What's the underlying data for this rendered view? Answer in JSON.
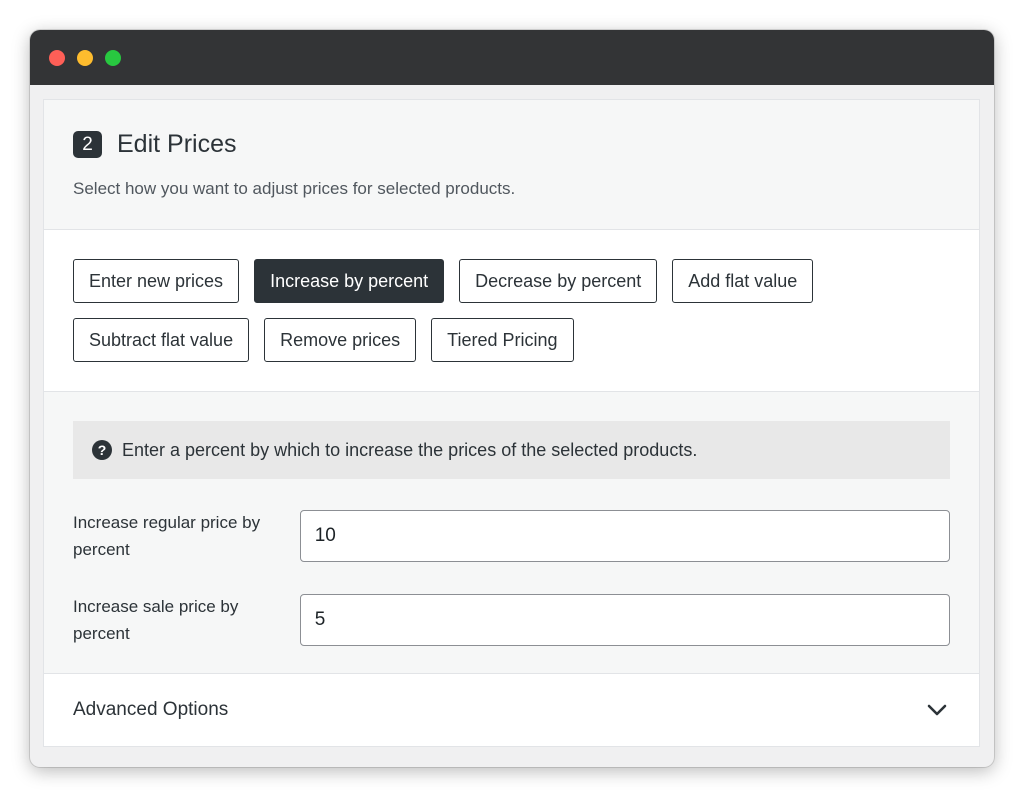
{
  "step": {
    "number": "2",
    "title": "Edit Prices",
    "subtitle": "Select how you want to adjust prices for selected products."
  },
  "options": {
    "row1": [
      {
        "label": "Enter new prices",
        "active": false
      },
      {
        "label": "Increase by percent",
        "active": true
      },
      {
        "label": "Decrease by percent",
        "active": false
      },
      {
        "label": "Add flat value",
        "active": false
      }
    ],
    "row2": [
      {
        "label": "Subtract flat value",
        "active": false
      },
      {
        "label": "Remove prices",
        "active": false
      },
      {
        "label": "Tiered Pricing",
        "active": false
      }
    ]
  },
  "notice": {
    "icon": "help-icon",
    "text": "Enter a percent by which to increase the prices of the selected products."
  },
  "fields": {
    "regular": {
      "label": "Increase regular price by percent",
      "value": "10"
    },
    "sale": {
      "label": "Increase sale price by percent",
      "value": "5"
    }
  },
  "advanced": {
    "label": "Advanced Options",
    "icon": "chevron-down-icon"
  },
  "colors": {
    "titlebar": "#333436",
    "accent": "#2c3338",
    "traffic_red": "#fe5f57",
    "traffic_yellow": "#febc2e",
    "traffic_green": "#28c840"
  }
}
